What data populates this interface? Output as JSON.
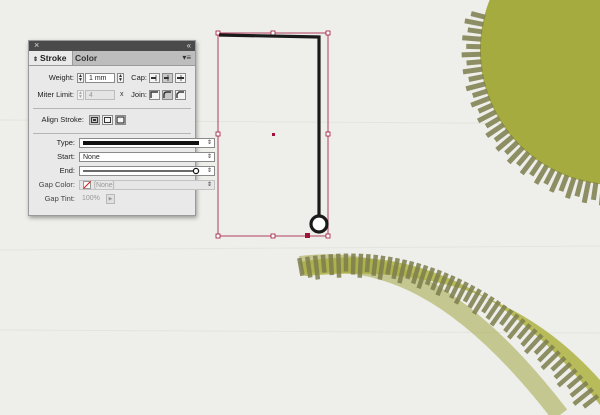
{
  "panel": {
    "tabs": [
      "Stroke",
      "Color"
    ],
    "weight": {
      "label": "Weight:",
      "value": "1 mm"
    },
    "cap": {
      "label": "Cap:"
    },
    "miter": {
      "label": "Miter Limit:",
      "value": "4",
      "suffix": "x"
    },
    "join": {
      "label": "Join:"
    },
    "align": {
      "label": "Align Stroke:"
    },
    "type": {
      "label": "Type:"
    },
    "start": {
      "label": "Start:",
      "value": "None"
    },
    "end": {
      "label": "End:"
    },
    "gap_color": {
      "label": "Gap Color:",
      "value": "[None]"
    },
    "gap_tint": {
      "label": "Gap Tint:",
      "value": "100%"
    }
  },
  "colors": {
    "selection": "#a1123b",
    "stroke": "#1a1a1a",
    "fill_green": "#a8ad45",
    "stitch": "#7d7e4c"
  }
}
